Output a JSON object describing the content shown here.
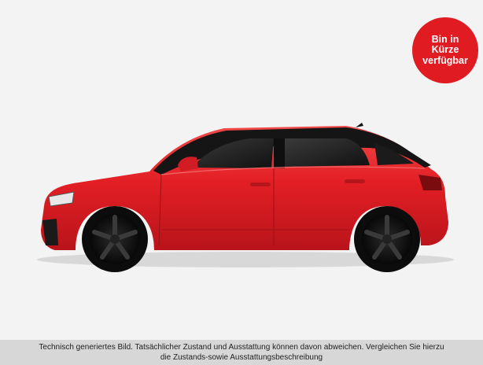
{
  "badge": {
    "text": "Bin in\nKürze\nverfügbar",
    "color": "#e11b22"
  },
  "car": {
    "description_icon": "car-side-view-image",
    "body_color": "#e31f25",
    "roof_color": "#151515"
  },
  "disclaimer": {
    "line1": "Technisch generiertes Bild. Tatsächlicher Zustand und Ausstattung können davon abweichen. Vergleichen Sie hierzu",
    "line2": "die Zustands-sowie Ausstattungsbeschreibung"
  }
}
